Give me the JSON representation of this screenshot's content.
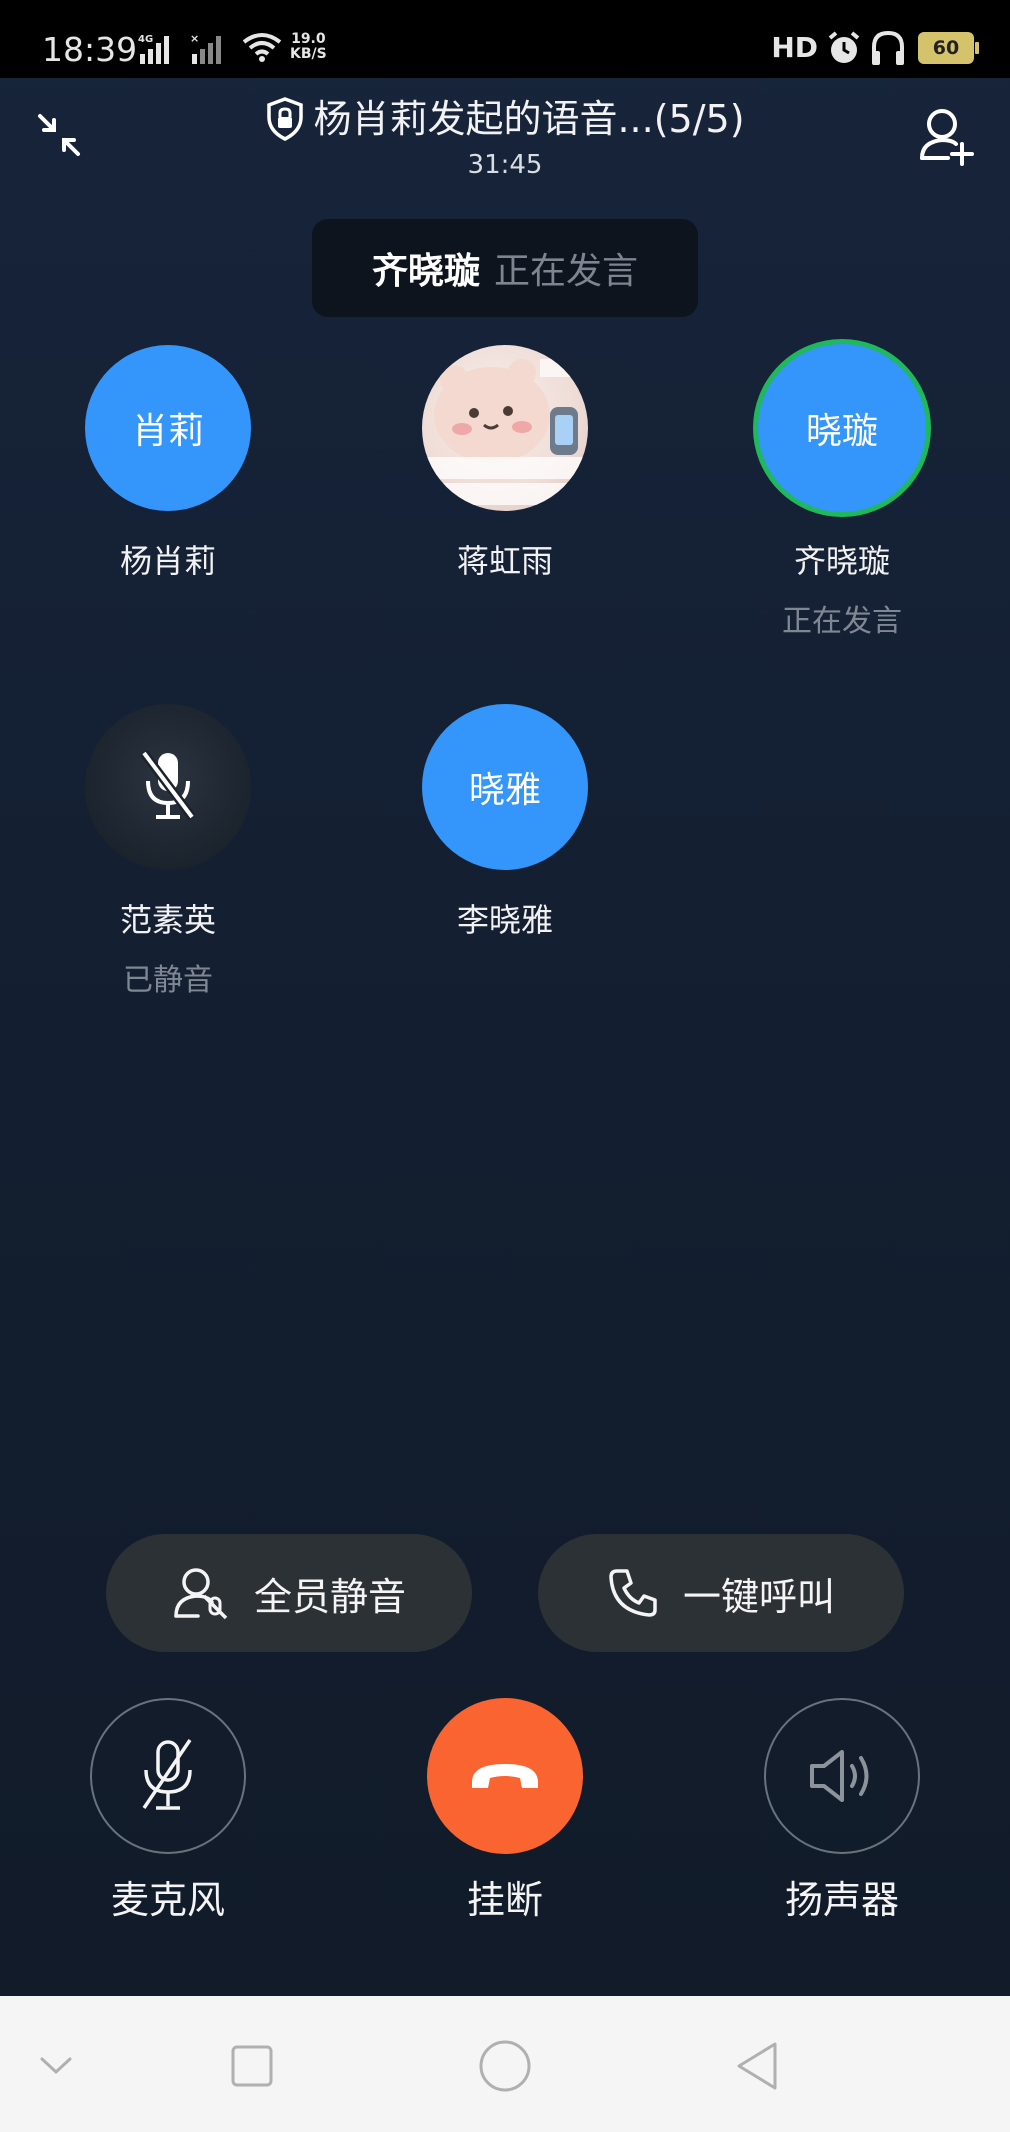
{
  "status_bar": {
    "time": "18:39",
    "net_speed_value": "19.0",
    "net_speed_unit": "KB/S",
    "hd_label": "HD",
    "battery": "60"
  },
  "header": {
    "title": "杨肖莉发起的语音...(5/5)",
    "timer": "31:45"
  },
  "speaking_banner": {
    "name": "齐晓璇",
    "status": "正在发言"
  },
  "participants": [
    {
      "avatar_text": "肖莉",
      "name": "杨肖莉",
      "status": ""
    },
    {
      "avatar_text": "",
      "name": "蒋虹雨",
      "status": ""
    },
    {
      "avatar_text": "晓璇",
      "name": "齐晓璇",
      "status": "正在发言"
    },
    {
      "avatar_text": "",
      "name": "范素英",
      "status": "已静音"
    },
    {
      "avatar_text": "晓雅",
      "name": "李晓雅",
      "status": ""
    }
  ],
  "actions": {
    "mute_all": "全员静音",
    "call_all": "一键呼叫"
  },
  "controls": {
    "mic": "麦克风",
    "hangup": "挂断",
    "speaker": "扬声器"
  },
  "colors": {
    "background": "#17243a",
    "avatar_blue": "#3495fa",
    "speaking_ring": "#1fb85d",
    "hangup": "#fa6430"
  }
}
